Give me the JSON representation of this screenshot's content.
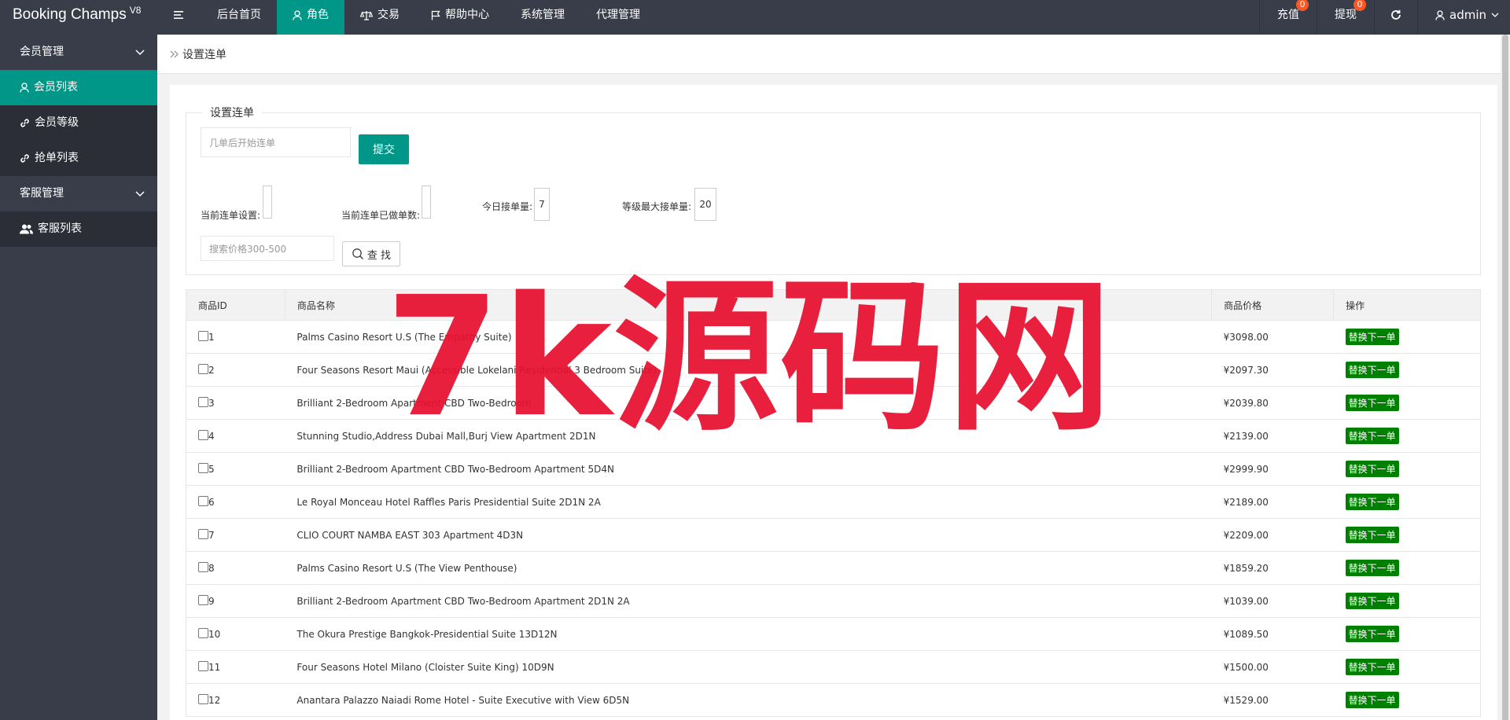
{
  "app": {
    "name": "Booking Champs",
    "version": "V8"
  },
  "topnav": {
    "items": [
      {
        "label": "后台首页",
        "active": false
      },
      {
        "label": "角色",
        "active": true
      },
      {
        "label": "交易",
        "active": false
      },
      {
        "label": "帮助中心",
        "active": false
      },
      {
        "label": "系统管理",
        "active": false
      },
      {
        "label": "代理管理",
        "active": false
      }
    ],
    "right": {
      "recharge": {
        "label": "充值",
        "badge": "0"
      },
      "withdraw": {
        "label": "提现",
        "badge": "0"
      },
      "user": "admin"
    }
  },
  "sidebar": {
    "groups": [
      {
        "label": "会员管理",
        "items": [
          {
            "label": "会员列表",
            "active": true
          },
          {
            "label": "会员等级",
            "active": false
          },
          {
            "label": "抢单列表",
            "active": false
          }
        ]
      },
      {
        "label": "客服管理",
        "items": [
          {
            "label": "客服列表",
            "active": false
          }
        ]
      }
    ]
  },
  "breadcrumb": {
    "current": "设置连单"
  },
  "form": {
    "legend": "设置连单",
    "order_input_placeholder": "几单后开始连单",
    "submit_label": "提交",
    "current_setting_label": "当前连单设置:",
    "current_setting_value": "",
    "done_count_label": "当前连单已做单数:",
    "done_count_value": "",
    "today_orders_label": "今日接单量:",
    "today_orders_value": "7",
    "max_orders_label": "等级最大接单量:",
    "max_orders_value": "20",
    "price_search_placeholder": "搜索价格300-500",
    "search_label": "查 找"
  },
  "table": {
    "headers": [
      "商品ID",
      "商品名称",
      "商品价格",
      "操作"
    ],
    "action_label": "替换下一单",
    "rows": [
      {
        "id": "1",
        "name": "Palms Casino Resort U.S (The Empathy Suite)",
        "price": "¥3098.00"
      },
      {
        "id": "2",
        "name": "Four Seasons Resort Maui (Accessible Lokelani Residential 3 Bedroom Suite)",
        "price": "¥2097.30"
      },
      {
        "id": "3",
        "name": "Brilliant 2-Bedroom Apartment CBD Two-Bedroom",
        "price": "¥2039.80"
      },
      {
        "id": "4",
        "name": "Stunning Studio,Address Dubai Mall,Burj View Apartment 2D1N",
        "price": "¥2139.00"
      },
      {
        "id": "5",
        "name": "Brilliant 2-Bedroom Apartment CBD Two-Bedroom Apartment 5D4N",
        "price": "¥2999.90"
      },
      {
        "id": "6",
        "name": "Le Royal Monceau Hotel Raffles Paris Presidential Suite 2D1N 2A",
        "price": "¥2189.00"
      },
      {
        "id": "7",
        "name": "CLIO COURT NAMBA EAST 303 Apartment 4D3N",
        "price": "¥2209.00"
      },
      {
        "id": "8",
        "name": "Palms Casino Resort U.S (The View Penthouse)",
        "price": "¥1859.20"
      },
      {
        "id": "9",
        "name": "Brilliant 2-Bedroom Apartment CBD Two-Bedroom Apartment 2D1N 2A",
        "price": "¥1039.00"
      },
      {
        "id": "10",
        "name": "The Okura Prestige Bangkok-Presidential Suite 13D12N",
        "price": "¥1089.50"
      },
      {
        "id": "11",
        "name": "Four Seasons Hotel Milano (Cloister Suite King) 10D9N",
        "price": "¥1500.00"
      },
      {
        "id": "12",
        "name": "Anantara Palazzo Naiadi Rome Hotel - Suite Executive with View 6D5N",
        "price": "¥1529.00"
      }
    ]
  },
  "watermark": "7k源码网",
  "colors": {
    "topbar": "#393d49",
    "accent": "#009688",
    "action": "#008000",
    "badge": "#ff5722",
    "watermark": "#e8102f"
  }
}
